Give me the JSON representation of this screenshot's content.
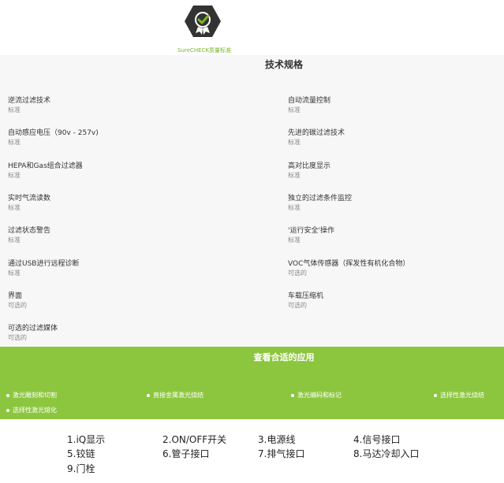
{
  "header": {
    "badge_caption": "SureCHECK质量标准",
    "badge_icon": "check-shield-icon",
    "accent_color": "#7ab52d"
  },
  "specs": {
    "title": "技术规格",
    "items": [
      {
        "name": "逆流过滤技术",
        "value": "标准"
      },
      {
        "name": "自动流量控制",
        "value": "标准"
      },
      {
        "name": "自动感应电压（90v - 257v)",
        "value": "标准"
      },
      {
        "name": "先进的碳过滤技术",
        "value": "标准"
      },
      {
        "name": "HEPA和Gas组合过滤器",
        "value": "标准"
      },
      {
        "name": "高对比度显示",
        "value": "标准"
      },
      {
        "name": "实时气流读数",
        "value": "标准"
      },
      {
        "name": "独立的过滤条件监控",
        "value": "标准"
      },
      {
        "name": "过滤状态警告",
        "value": "标准"
      },
      {
        "name": "'运行安全'操作",
        "value": "标准"
      },
      {
        "name": "通过USB进行远程诊断",
        "value": "标准"
      },
      {
        "name": "VOC气体传感器（挥发性有机化合物）",
        "value": "可选的"
      },
      {
        "name": "界面",
        "value": "可选的"
      },
      {
        "name": "车载压缩机",
        "value": "可选的"
      },
      {
        "name": "可选的过滤媒体",
        "value": "可选的"
      }
    ]
  },
  "applications": {
    "title": "查看合适的应用",
    "background_color": "#8cc63f",
    "items": [
      {
        "label": "激光雕刻和切割"
      },
      {
        "label": "直接金属激光烧结"
      },
      {
        "label": "激光编码和标记"
      },
      {
        "label": "选择性激光烧结"
      },
      {
        "label": "选择性激光熔化"
      }
    ]
  },
  "parts": {
    "items": [
      {
        "label": "1.iQ显示"
      },
      {
        "label": "2.ON/OFF开关"
      },
      {
        "label": "3.电源线"
      },
      {
        "label": "4.信号接口"
      },
      {
        "label": "5.铰链"
      },
      {
        "label": "6.管子接口"
      },
      {
        "label": "7.排气接口"
      },
      {
        "label": "8.马达冷却入口"
      },
      {
        "label": "9.门栓"
      }
    ]
  }
}
